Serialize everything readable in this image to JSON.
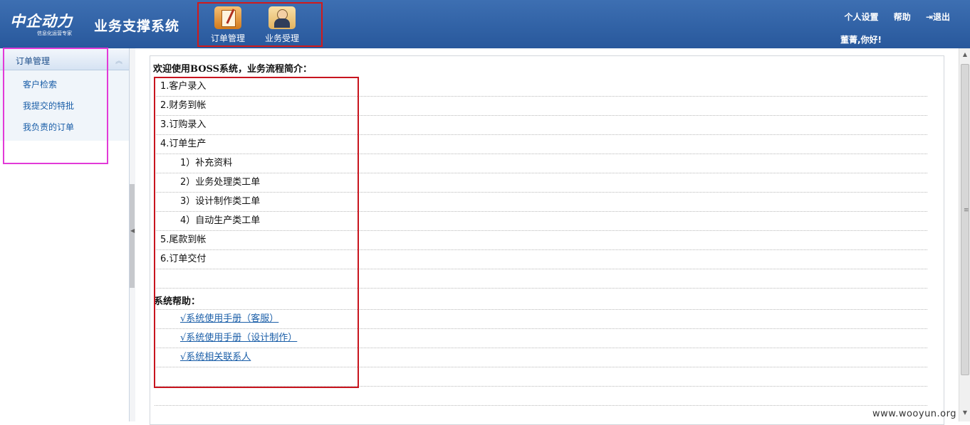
{
  "header": {
    "logo_script": "中企动力",
    "logo_tagline": "信息化运营专家",
    "system_title": "业务支撑系统",
    "nav": [
      {
        "label": "订单管理",
        "icon": "order-book-icon"
      },
      {
        "label": "业务受理",
        "icon": "service-agent-icon"
      }
    ],
    "links": {
      "settings": "个人设置",
      "help": "帮助",
      "logout": "退出"
    },
    "greeting": "董菁,你好!"
  },
  "sidebar": {
    "section_title": "订单管理",
    "items": [
      "客户检索",
      "我提交的特批",
      "我负责的订单"
    ]
  },
  "main": {
    "intro": "欢迎使用BOSS系统，业务流程简介：",
    "steps": [
      "1.客户录入",
      "2.财务到帐",
      "3.订购录入",
      "4.订单生产",
      "1）补充资料",
      "2）业务处理类工单",
      "3）设计制作类工单",
      "4）自动生产类工单",
      "5.尾款到帐",
      "6.订单交付"
    ],
    "help_title": "系统帮助：",
    "help_links": [
      "√系统使用手册（客服）",
      "√系统使用手册（设计制作）",
      "√系统相关联系人"
    ]
  },
  "watermark": "www.wooyun.org",
  "colors": {
    "header_bg": "#2f62a8",
    "highlight_red": "#c8141e",
    "highlight_magenta": "#e23ad8",
    "link": "#1a5ea8"
  }
}
